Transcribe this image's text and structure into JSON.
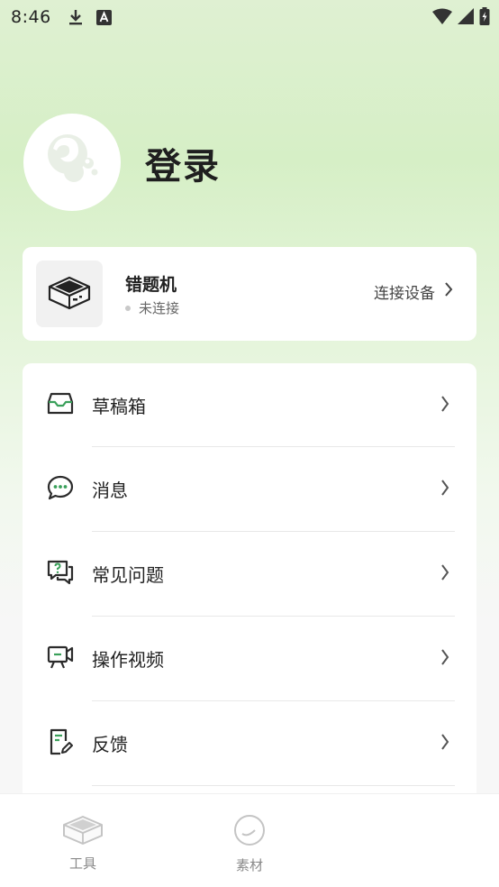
{
  "status_bar": {
    "time": "8:46",
    "icons": [
      "download-icon",
      "font-icon",
      "wifi-icon",
      "signal-icon",
      "battery-icon"
    ]
  },
  "profile": {
    "login_label": "登录",
    "avatar_icon": "bubble-logo-icon"
  },
  "device": {
    "name": "错题机",
    "status": "未连接",
    "connect_label": "连接设备",
    "icon": "printer-device-icon"
  },
  "menu": {
    "items": [
      {
        "label": "草稿箱",
        "icon": "inbox-icon"
      },
      {
        "label": "消息",
        "icon": "chat-bubble-icon"
      },
      {
        "label": "常见问题",
        "icon": "faq-icon"
      },
      {
        "label": "操作视频",
        "icon": "video-icon"
      },
      {
        "label": "反馈",
        "icon": "feedback-icon"
      }
    ]
  },
  "tabs": [
    {
      "label": "工具",
      "icon": "printer-tab-icon"
    },
    {
      "label": "素材",
      "icon": "material-icon"
    }
  ],
  "colors": {
    "accent": "#3aa05a",
    "icon_stroke": "#2b2b2b"
  }
}
